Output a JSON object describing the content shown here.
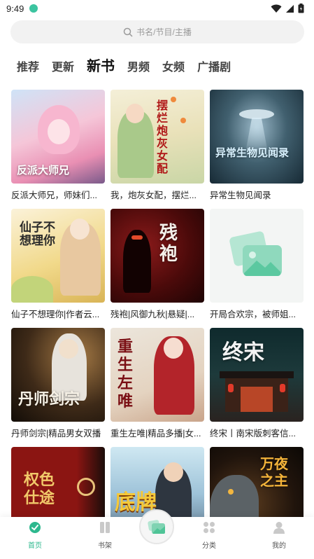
{
  "status": {
    "time": "9:49"
  },
  "search": {
    "placeholder": "书名/节目/主播"
  },
  "tabs": [
    {
      "label": "推荐",
      "active": false
    },
    {
      "label": "更新",
      "active": false
    },
    {
      "label": "新书",
      "active": true
    },
    {
      "label": "男频",
      "active": false
    },
    {
      "label": "女频",
      "active": false
    },
    {
      "label": "广播剧",
      "active": false
    }
  ],
  "books": [
    {
      "title": "反派大师兄，师妹们...",
      "cover_text": "反派大师兄"
    },
    {
      "title": "我，炮灰女配，摆烂...",
      "cover_text": "摆烂炮灰女配"
    },
    {
      "title": "异常生物见闻录",
      "cover_text": "异常生物见闻录"
    },
    {
      "title": "仙子不想理你|作者云...",
      "cover_text": "仙子不想理你"
    },
    {
      "title": "残袍|风御九秋|悬疑|...",
      "cover_text": "残袍"
    },
    {
      "title": "开局合欢宗，被师姐...",
      "cover_text": ""
    },
    {
      "title": "丹师剑宗|精品男女双播",
      "cover_text": "丹师剑宗"
    },
    {
      "title": "重生左唯|精品多播|女...",
      "cover_text": "重生左唯"
    },
    {
      "title": "终宋丨南宋版刺客信...",
      "cover_text": "终宋"
    },
    {
      "title": "",
      "cover_text": "权色仕途"
    },
    {
      "title": "",
      "cover_text": "底牌"
    },
    {
      "title": "",
      "cover_text": "万夜之主"
    }
  ],
  "nav": {
    "home": "首页",
    "shelf": "书架",
    "category": "分类",
    "mine": "我的"
  },
  "colors": {
    "accent": "#2db88e"
  }
}
